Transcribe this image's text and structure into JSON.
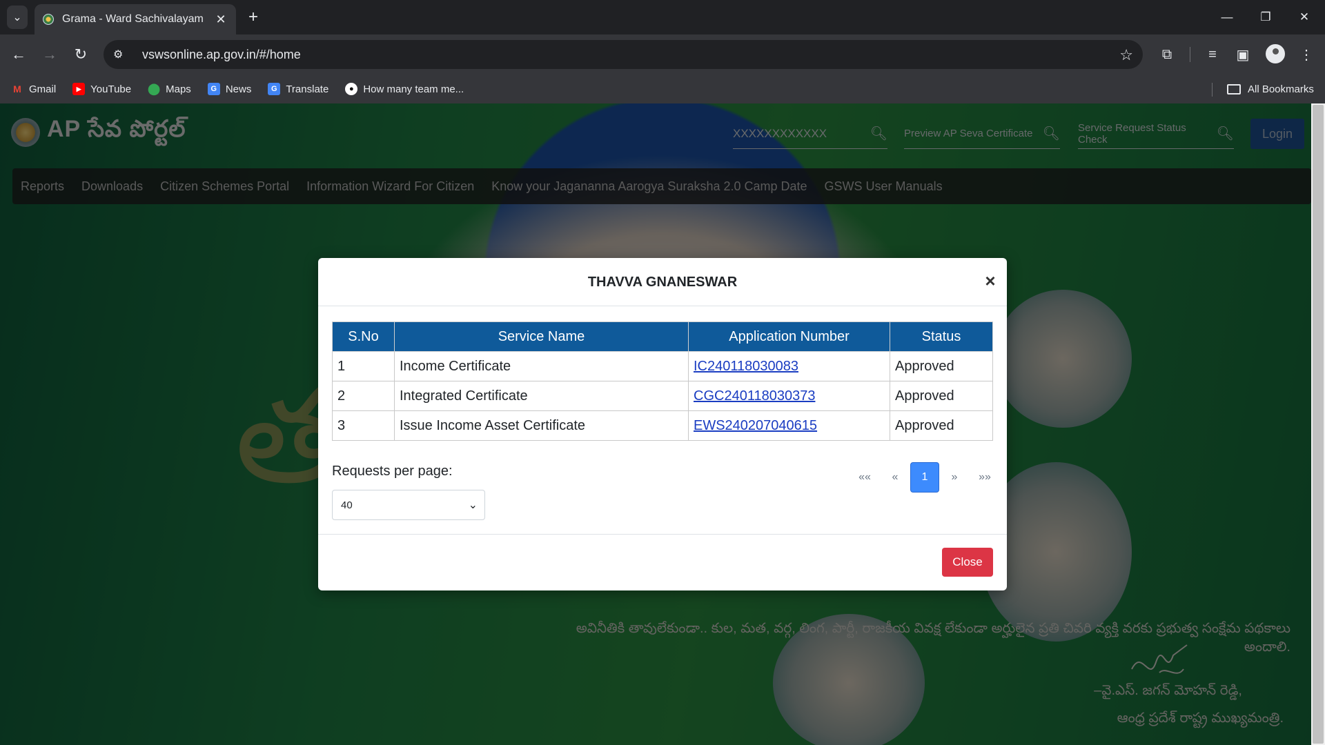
{
  "browser": {
    "tab_title": "Grama - Ward Sachivalayam",
    "url": "vswsonline.ap.gov.in/#/home",
    "bookmarks": [
      {
        "label": "Gmail",
        "icon": "gmail-icon",
        "color": "#ea4335"
      },
      {
        "label": "YouTube",
        "icon": "youtube-icon",
        "color": "#ff0000"
      },
      {
        "label": "Maps",
        "icon": "maps-icon",
        "color": "#34a853"
      },
      {
        "label": "News",
        "icon": "news-icon",
        "color": "#4285f4"
      },
      {
        "label": "Translate",
        "icon": "translate-icon",
        "color": "#4285f4"
      },
      {
        "label": "How many team me...",
        "icon": "github-icon",
        "color": "#ffffff"
      }
    ],
    "all_bookmarks": "All Bookmarks"
  },
  "site": {
    "logo_text": "AP సేవ పోర్టల్",
    "search_placeholder": "XXXXXXXXXXXX",
    "preview_label": "Preview AP Seva Certificate",
    "status_check_label": "Service Request Status Check",
    "login_label": "Login",
    "nav": [
      "Reports",
      "Downloads",
      "Citizen Schemes Portal",
      "Information Wizard For Citizen",
      "Know your Jagananna Aarogya Suraksha 2.0 Camp Date",
      "GSWS User Manuals"
    ],
    "quote": "అవినీతికి తావులేకుండా.. కుల, మత, వర్గ, లింగ, పార్టీ, రాజకీయ వివక్ష లేకుండా అర్హులైన ప్రతి చివరి వ్యక్తి వరకు ప్రభుత్వ సంక్షేమ పథకాలు అందాలి.",
    "sign_name": "–వై.ఎస్. జగన్ మోహన్ రెడ్డి,",
    "sign_title": "ఆంధ్ర ప్రదేశ్ రాష్ట్ర ముఖ్యమంత్రి."
  },
  "modal": {
    "title": "THAVVA GNANESWAR",
    "columns": [
      "S.No",
      "Service Name",
      "Application Number",
      "Status"
    ],
    "rows": [
      {
        "sno": "1",
        "service": "Income Certificate",
        "app_no": "IC240118030083",
        "status": "Approved"
      },
      {
        "sno": "2",
        "service": "Integrated Certificate",
        "app_no": "CGC240118030373",
        "status": "Approved"
      },
      {
        "sno": "3",
        "service": "Issue Income Asset Certificate",
        "app_no": "EWS240207040615",
        "status": "Approved"
      }
    ],
    "rpp_label": "Requests per page:",
    "rpp_value": "40",
    "pager": {
      "first": "««",
      "prev": "«",
      "current": "1",
      "next": "»",
      "last": "»»"
    },
    "close_label": "Close"
  }
}
